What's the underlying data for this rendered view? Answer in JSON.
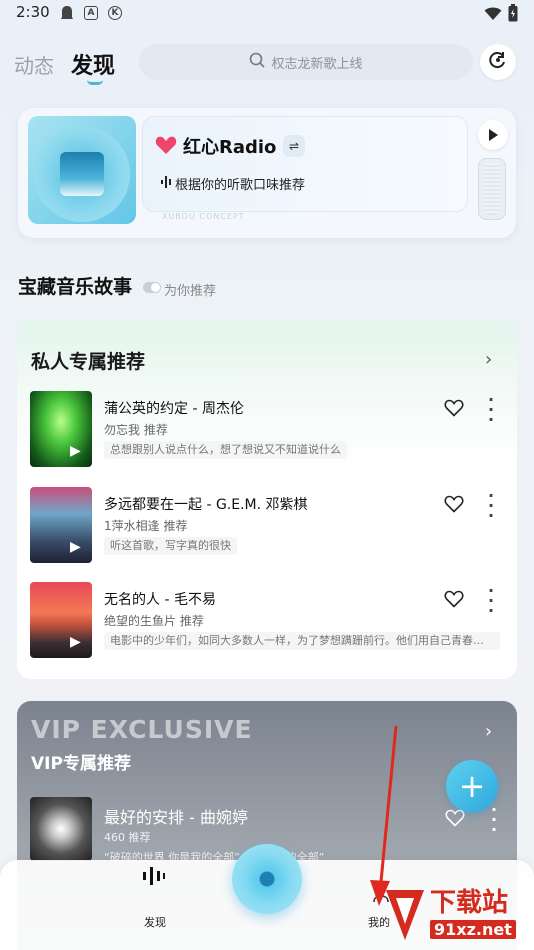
{
  "status": {
    "time": "2:30",
    "icons": [
      "ghost-icon",
      "a-icon",
      "k-icon"
    ],
    "right_icons": [
      "wifi-icon",
      "battery-icon"
    ]
  },
  "nav": {
    "tabs": [
      {
        "label": "动态",
        "active": false
      },
      {
        "label": "发现",
        "active": true
      }
    ],
    "search_placeholder": "权志龙新歌上线"
  },
  "radio": {
    "title": "红心Radio",
    "subtitle": "根据你的听歌口味推荐",
    "art_text": "XUBOU CONCEPT"
  },
  "story": {
    "title": "宝藏音乐故事",
    "toggle_label": "为你推荐"
  },
  "private": {
    "title": "私人专属推荐",
    "songs": [
      {
        "name": "蒲公英的约定 - 周杰伦",
        "rec": "勿忘我 推荐",
        "quote": "总想跟别人说点什么，想了想说又不知道说什么"
      },
      {
        "name": "多远都要在一起 - G.E.M. 邓紫棋",
        "rec": "1萍水相逢 推荐",
        "quote": "听这首歌，写字真的很快"
      },
      {
        "name": "无名的人 - 毛不易",
        "rec": "绝望的生鱼片 推荐",
        "quote": "电影中的少年们，如同大多数人一样，为了梦想蹒跚前行。他们用自己青春和..."
      }
    ]
  },
  "vip": {
    "big_title": "VIP EXCLUSIVE",
    "subtitle": "VIP专属推荐",
    "song": {
      "name": "最好的安排 - 曲婉婷",
      "count": "460 推荐",
      "quote": "“破碎的世界 你是我的全部” “你 是我的全部”"
    }
  },
  "bottom_nav": {
    "discover": "发现",
    "mine": "我的"
  },
  "watermark": {
    "text": "下载站",
    "url": "91xz.net"
  },
  "colors": {
    "accent": "#4bb6d9",
    "fab": "#2ea8de",
    "heart": "#f0456a",
    "watermark": "#d42b1e"
  }
}
